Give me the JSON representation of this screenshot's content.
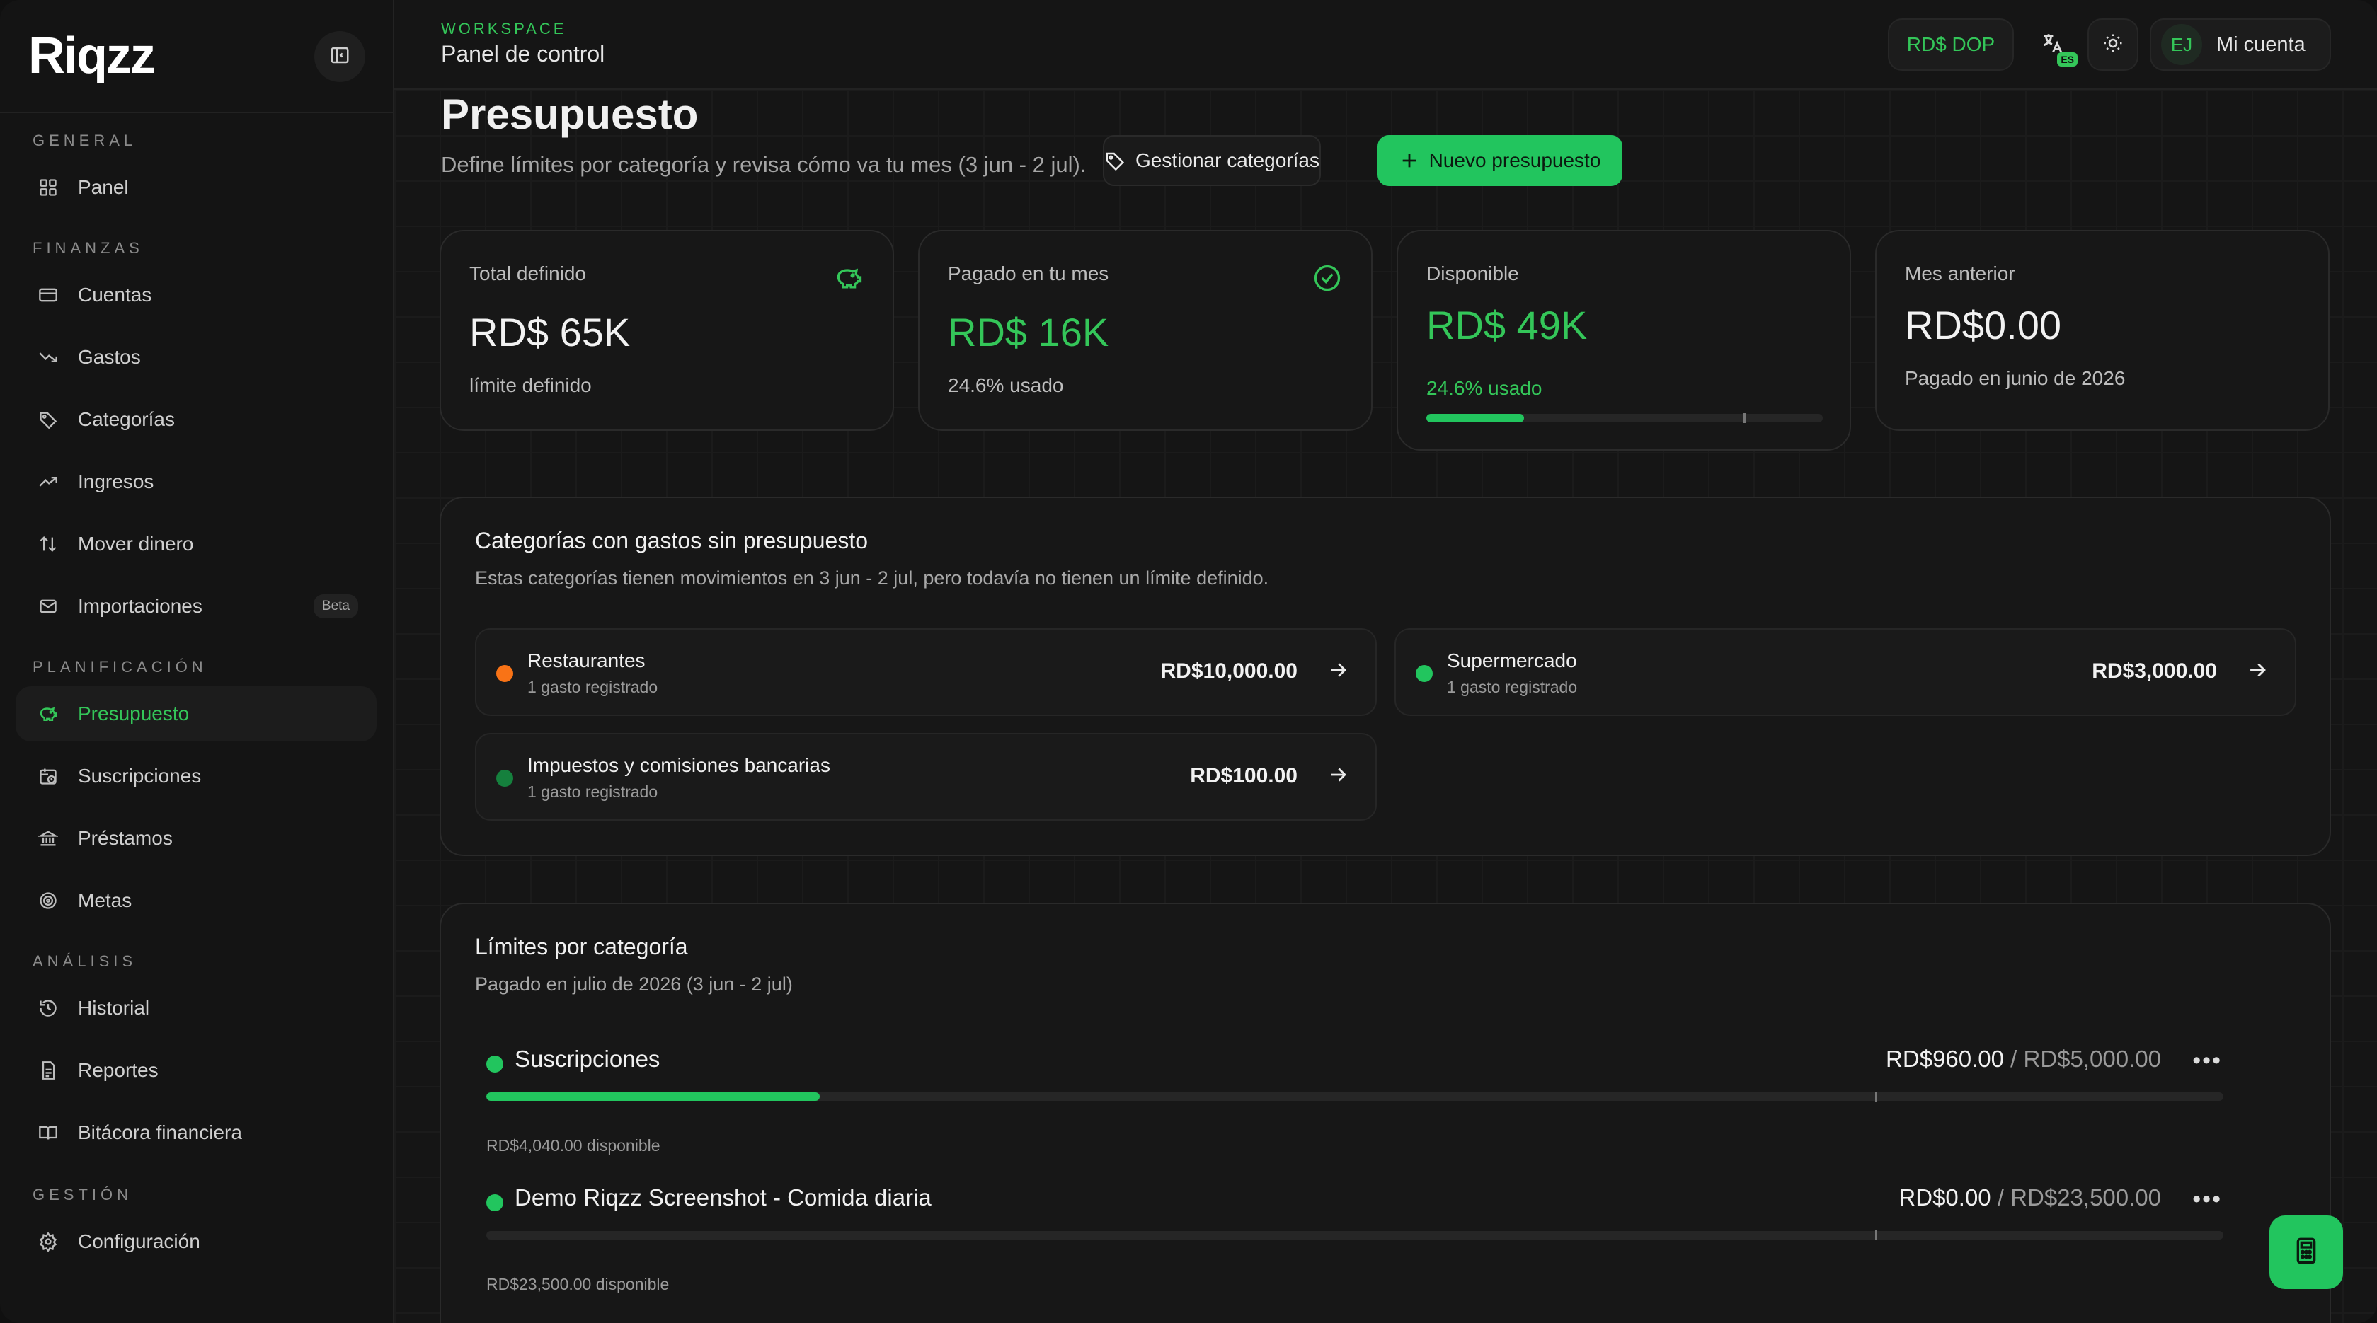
{
  "brand": {
    "logo": "Riqzz",
    "accent": "#22c55e"
  },
  "sidebar": {
    "sections": [
      {
        "label": "GENERAL"
      },
      {
        "label": "FINANZAS"
      },
      {
        "label": "PLANIFICACIÓN"
      },
      {
        "label": "ANÁLISIS"
      },
      {
        "label": "GESTIÓN"
      }
    ],
    "items": [
      {
        "label": "Panel",
        "icon": "dashboard-icon"
      },
      {
        "label": "Cuentas",
        "icon": "card-icon"
      },
      {
        "label": "Gastos",
        "icon": "trend-down-icon"
      },
      {
        "label": "Categorías",
        "icon": "tag-icon"
      },
      {
        "label": "Ingresos",
        "icon": "trend-up-icon"
      },
      {
        "label": "Mover dinero",
        "icon": "transfer-icon"
      },
      {
        "label": "Importaciones",
        "icon": "mail-icon",
        "badge": "Beta"
      },
      {
        "label": "Presupuesto",
        "icon": "piggy-bank-icon",
        "active": true
      },
      {
        "label": "Suscripciones",
        "icon": "calendar-clock-icon"
      },
      {
        "label": "Préstamos",
        "icon": "bank-icon"
      },
      {
        "label": "Metas",
        "icon": "target-icon"
      },
      {
        "label": "Historial",
        "icon": "history-icon"
      },
      {
        "label": "Reportes",
        "icon": "report-icon"
      },
      {
        "label": "Bitácora financiera",
        "icon": "book-icon"
      },
      {
        "label": "Configuración",
        "icon": "gear-icon"
      }
    ]
  },
  "topbar": {
    "workspace_label": "WORKSPACE",
    "workspace_title": "Panel de control",
    "currency": "RD$ DOP",
    "language_badge": "ES",
    "avatar_initials": "EJ",
    "account_label": "Mi cuenta"
  },
  "page": {
    "title": "Presupuesto",
    "subtitle": "Define límites por categoría y revisa cómo va tu mes (3 jun - 2 jul).",
    "manage_button": "Gestionar categorías",
    "new_button": "Nuevo presupuesto"
  },
  "stats": [
    {
      "title": "Total definido",
      "value": "RD$ 65K",
      "sub": "límite definido",
      "icon": "piggy-bank-icon"
    },
    {
      "title": "Pagado en tu mes",
      "value": "RD$ 16K",
      "sub": "24.6% usado",
      "icon": "check-circle-icon"
    },
    {
      "title": "Disponible",
      "value": "RD$ 49K",
      "sub": "24.6% usado",
      "progress": 0.246
    },
    {
      "title": "Mes anterior",
      "value": "RD$0.00",
      "sub": "Pagado en junio de 2026"
    }
  ],
  "unbudgeted": {
    "title": "Categorías con gastos sin presupuesto",
    "subtitle": "Estas categorías tienen movimientos en 3 jun - 2 jul, pero todavía no tienen un límite definido.",
    "items": [
      {
        "name": "Restaurantes",
        "count": "1 gasto registrado",
        "amount": "RD$10,000.00",
        "color": "#f97316"
      },
      {
        "name": "Supermercado",
        "count": "1 gasto registrado",
        "amount": "RD$3,000.00",
        "color": "#22c55e"
      },
      {
        "name": "Impuestos y comisiones bancarias",
        "count": "1 gasto registrado",
        "amount": "RD$100.00",
        "color": "#15803d"
      }
    ]
  },
  "limits": {
    "title": "Límites por categoría",
    "subtitle": "Pagado en julio de 2026 (3 jun - 2 jul)",
    "separator": "/",
    "items": [
      {
        "name": "Suscripciones",
        "spent": "RD$960.00",
        "total": "RD$5,000.00",
        "available": "RD$4,040.00 disponible",
        "progress": 0.192
      },
      {
        "name": "Demo Riqzz Screenshot - Comida diaria",
        "spent": "RD$0.00",
        "total": "RD$23,500.00",
        "available": "RD$23,500.00 disponible",
        "progress": 0
      }
    ]
  }
}
